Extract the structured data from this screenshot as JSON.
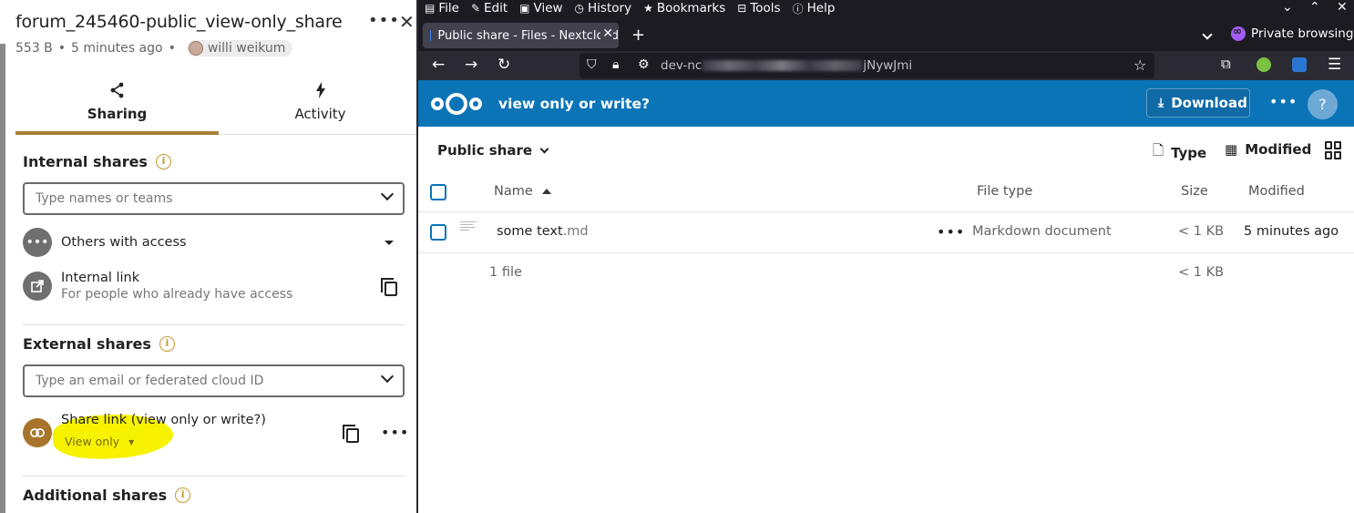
{
  "sidebar": {
    "file_title": "forum_245460-public_view-only_share",
    "more": "•••",
    "close": "✕",
    "meta": {
      "size": "553 B",
      "time": "5 minutes ago",
      "user": "willi weikum"
    },
    "tabs": [
      {
        "label": "Sharing",
        "icon": "share-icon"
      },
      {
        "label": "Activity",
        "icon": "lightning-icon"
      }
    ],
    "internal": {
      "heading": "Internal shares",
      "placeholder": "Type names or teams",
      "others_access": "Others with access",
      "internal_link": "Internal link",
      "internal_link_sub": "For people who already have access"
    },
    "external": {
      "heading": "External shares",
      "placeholder": "Type an email or federated cloud ID",
      "share_link": "Share link (view only or write?)",
      "permission": "View only"
    },
    "additional": {
      "heading": "Additional shares"
    },
    "highlight_color": "#f6f200",
    "accent_color": "#a88036"
  },
  "browser": {
    "menu": [
      {
        "icon": "file-icon",
        "label": "File",
        "u": "F"
      },
      {
        "icon": "edit-icon",
        "label": "Edit",
        "u": "E"
      },
      {
        "icon": "view-icon",
        "label": "View",
        "u": "V"
      },
      {
        "icon": "history-icon",
        "label": "History",
        "u": "s"
      },
      {
        "icon": "star-icon",
        "label": "Bookmarks",
        "u": "B"
      },
      {
        "icon": "tools-icon",
        "label": "Tools",
        "u": "T"
      },
      {
        "icon": "help-icon",
        "label": "Help",
        "u": "H"
      }
    ],
    "tab_title": "Public share - Files - Nextcloud",
    "private_label": "Private browsing",
    "url_prefix": "dev-nc",
    "url_suffix": "jNywJmi"
  },
  "nextcloud": {
    "header_title": "view only or write?",
    "download_label": "Download",
    "help": "?",
    "brand_color": "#0b74b7",
    "breadcrumb": "Public share",
    "filters": {
      "type": "Type",
      "modified": "Modified"
    },
    "columns": {
      "name": "Name",
      "file_type": "File type",
      "size": "Size",
      "modified": "Modified"
    },
    "files": [
      {
        "name": "some text",
        "ext": ".md",
        "type": "Markdown document",
        "size": "< 1 KB",
        "modified": "5 minutes ago"
      }
    ],
    "summary": {
      "count": "1 file",
      "size": "< 1 KB"
    }
  }
}
